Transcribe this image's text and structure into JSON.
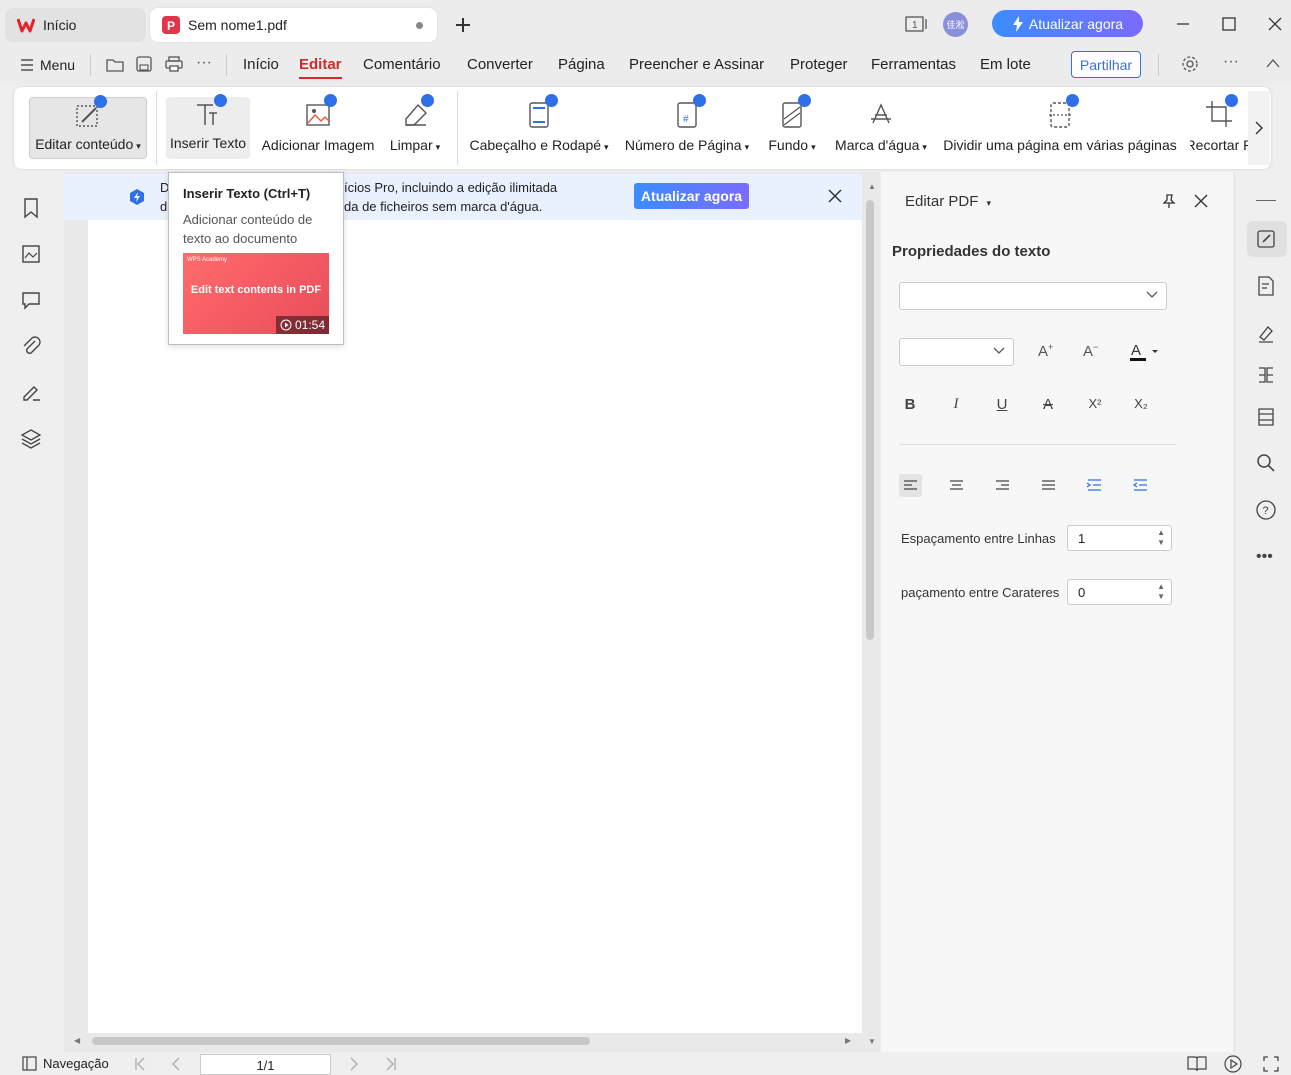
{
  "titlebar": {
    "home_tab": "Início",
    "doc_tab": "Sem nome1.pdf",
    "upgrade": "Atualizar agora",
    "avatar_text": "佳淞"
  },
  "menubar": {
    "menu": "Menu",
    "items": [
      "Início",
      "Editar",
      "Comentário",
      "Converter",
      "Página",
      "Preencher e Assinar",
      "Proteger",
      "Ferramentas",
      "Em lote"
    ],
    "active": "Editar",
    "share": "Partilhar"
  },
  "ribbon": {
    "edit_content": "Editar conteúdo",
    "insert_text": "Inserir Texto",
    "add_image": "Adicionar Imagem",
    "clear": "Limpar",
    "header_footer": "Cabeçalho e Rodapé",
    "page_number": "Número de Página",
    "background": "Fundo",
    "watermark": "Marca d'água",
    "split_page": "Dividir uma página em várias páginas",
    "crop": "Recortar P"
  },
  "banner": {
    "line1_a": "D",
    "line1_b": "ícios Pro, incluindo a edição ilimitada",
    "line2_a": "d",
    "line2_b": "da de ficheiros sem marca d'água.",
    "button": "Atualizar agora"
  },
  "tooltip": {
    "title": "Inserir Texto (Ctrl+T)",
    "description": "Adicionar conteúdo de texto ao documento",
    "thumb_brand": "WPS Academy",
    "thumb_text": "Edit text contents in PDF",
    "duration": "01:54"
  },
  "panel": {
    "title": "Editar PDF",
    "section": "Propriedades do texto",
    "line_spacing_label": "Espaçamento entre Linhas",
    "line_spacing_value": "1",
    "char_spacing_label": "paçamento entre Carateres",
    "char_spacing_value": "0",
    "format_buttons": [
      "B",
      "I",
      "U",
      "A",
      "X²",
      "X₂"
    ]
  },
  "statusbar": {
    "navigation": "Navegação",
    "page": "1/1"
  }
}
